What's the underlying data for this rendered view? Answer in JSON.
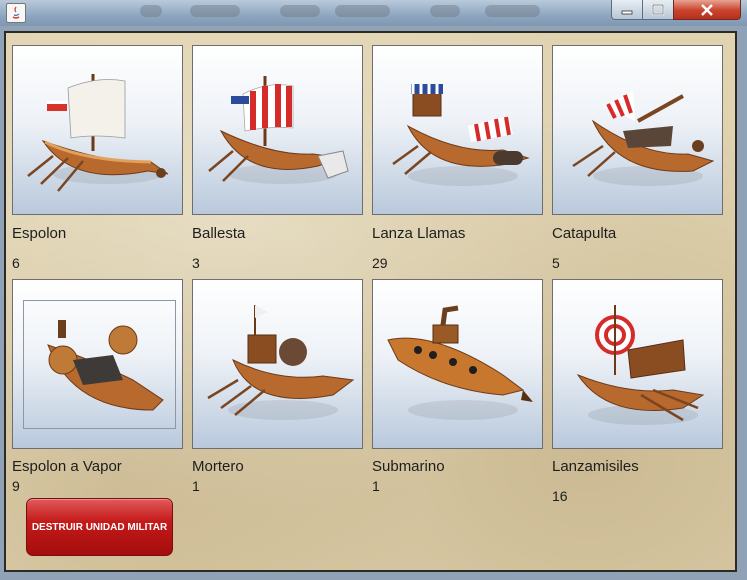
{
  "window": {
    "title": "",
    "icon": "java-icon"
  },
  "units": [
    {
      "name": "Espolon",
      "count": "6",
      "icon": "ram-ship-icon"
    },
    {
      "name": "Ballesta",
      "count": "3",
      "icon": "ballista-ship-icon"
    },
    {
      "name": "Lanza Llamas",
      "count": "29",
      "icon": "flamethrower-ship-icon"
    },
    {
      "name": "Catapulta",
      "count": "5",
      "icon": "catapult-ship-icon"
    },
    {
      "name": "Espolon a Vapor",
      "count": "9",
      "icon": "steam-ram-ship-icon",
      "selected": true
    },
    {
      "name": "Mortero",
      "count": "1",
      "icon": "mortar-ship-icon"
    },
    {
      "name": "Submarino",
      "count": "1",
      "icon": "submarine-icon"
    },
    {
      "name": "Lanzamisiles",
      "count": "16",
      "icon": "missile-ship-icon"
    }
  ],
  "destroy_button": {
    "label": "DESTRUIR UNIDAD MILITAR"
  },
  "colors": {
    "close_button": "#c9422b",
    "destroy_button": "#c41a1a",
    "parchment": "#e0d3b0"
  }
}
